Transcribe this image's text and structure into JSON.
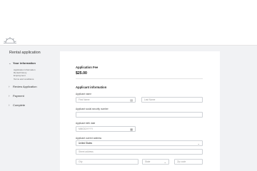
{
  "header": {
    "logo_icon": "sunrise-logo-icon"
  },
  "sidebar": {
    "app_title": "Rental application",
    "steps": [
      {
        "label": "Your information",
        "chevron": "⌄",
        "active": true,
        "substeps": [
          "Application Information",
          "Rental history",
          "Employment",
          "Terms and conditions"
        ]
      },
      {
        "label": "Review Application",
        "chevron": "›"
      },
      {
        "label": "Payment",
        "chevron": "›"
      },
      {
        "label": "Complete",
        "chevron": "›"
      }
    ]
  },
  "main": {
    "fee": {
      "title": "Application Fee",
      "amount": "$25.00"
    },
    "applicant": {
      "section_title": "Applicant information",
      "name_label": "Applicant name",
      "first_name_placeholder": "First Name",
      "last_name_placeholder": "Last Name",
      "ssn_label": "Applicant social security number",
      "birth_label": "Applicant birth date",
      "birth_placeholder": "MM/DD/YYYY",
      "address_label": "Applicant current address",
      "country_value": "United States",
      "street_placeholder": "Street address",
      "city_placeholder": "City",
      "state_placeholder": "State",
      "zip_placeholder": "Zip code"
    },
    "icons": {
      "contact_card": "contact-card-icon",
      "calendar": "calendar-icon",
      "chevron_down": "chevron-down-icon"
    }
  }
}
